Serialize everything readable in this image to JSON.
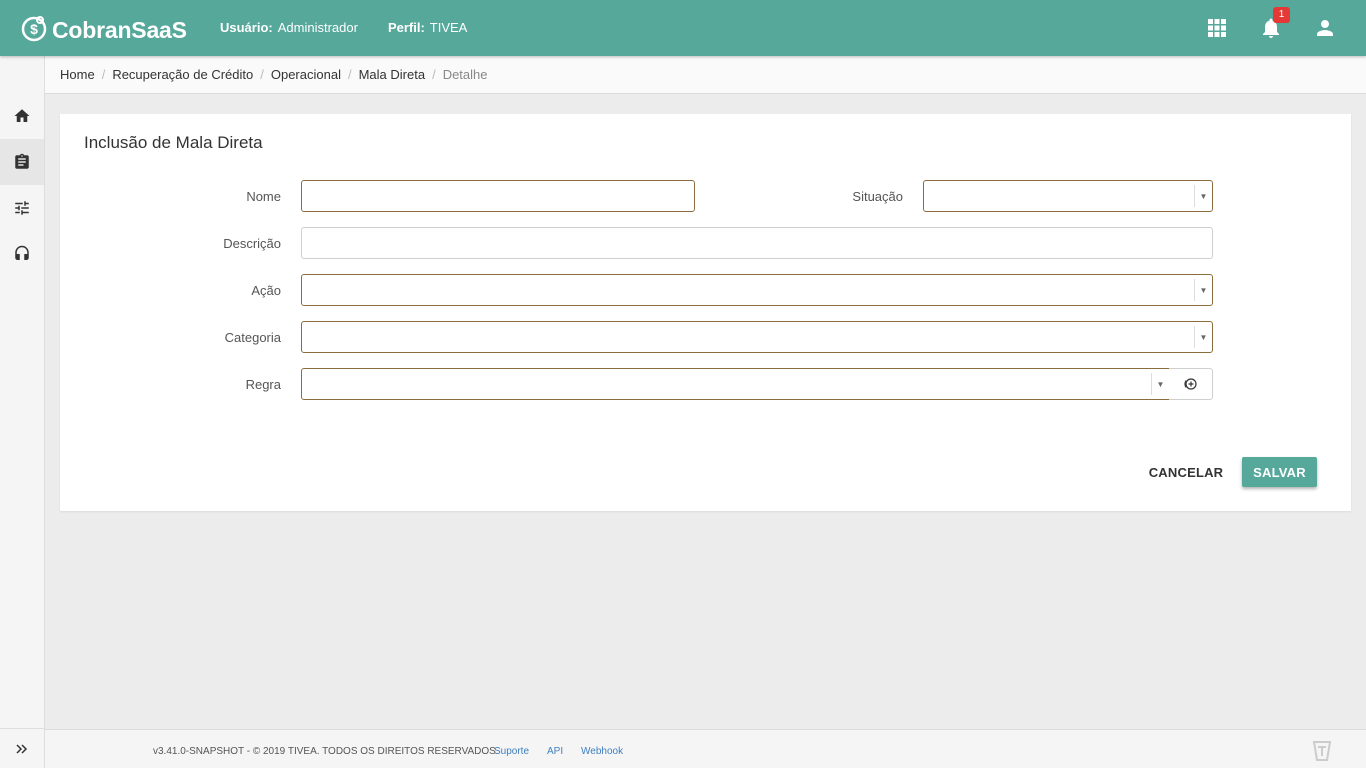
{
  "header": {
    "brand": "CobranSaaS",
    "user_key": "Usuário:",
    "user_value": "Administrador",
    "profile_key": "Perfil:",
    "profile_value": "TIVEA",
    "notification_count": "1",
    "icons": [
      "apps-grid-icon",
      "bell-icon",
      "account-icon"
    ]
  },
  "sidebar": {
    "items": [
      {
        "icon": "home-icon"
      },
      {
        "icon": "clipboard-icon",
        "active": true
      },
      {
        "icon": "tune-sliders-icon"
      },
      {
        "icon": "headset-icon"
      }
    ],
    "expand_icon": "double-chevron-right-icon"
  },
  "breadcrumb": [
    "Home",
    "Recuperação de Crédito",
    "Operacional",
    "Mala Direta",
    "Detalhe"
  ],
  "form": {
    "title": "Inclusão de Mala Direta",
    "labels": {
      "nome": "Nome",
      "situacao": "Situação",
      "descricao": "Descrição",
      "acao": "Ação",
      "categoria": "Categoria",
      "regra": "Regra"
    },
    "values": {
      "nome": "",
      "situacao": "",
      "descricao": "",
      "acao": "",
      "categoria": "",
      "regra": ""
    },
    "cancel_label": "CANCELAR",
    "save_label": "SALVAR"
  },
  "footer": {
    "copyright": "v3.41.0-SNAPSHOT - © 2019 TIVEA. TODOS OS DIREITOS RESERVADOS.",
    "links": [
      "Suporte",
      "API",
      "Webhook"
    ]
  },
  "colors": {
    "primary": "#56a89b",
    "field_border": "#8a6d3b",
    "badge": "#e53935",
    "link": "#3f7fbf"
  }
}
